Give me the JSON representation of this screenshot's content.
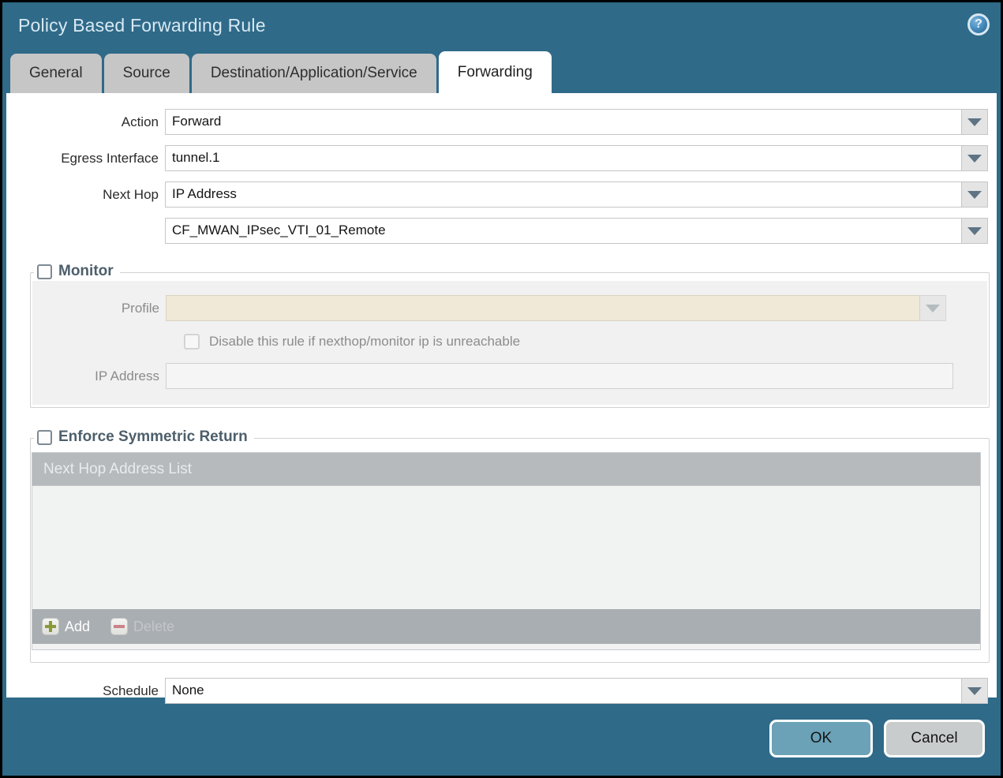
{
  "dialog": {
    "title": "Policy Based Forwarding Rule",
    "help_icon": "question-mark-circle",
    "help_glyph": "?"
  },
  "tabs": [
    {
      "label": "General",
      "active": false
    },
    {
      "label": "Source",
      "active": false
    },
    {
      "label": "Destination/Application/Service",
      "active": false
    },
    {
      "label": "Forwarding",
      "active": true
    }
  ],
  "form": {
    "action": {
      "label": "Action",
      "value": "Forward"
    },
    "egress_interface": {
      "label": "Egress Interface",
      "value": "tunnel.1"
    },
    "next_hop": {
      "label": "Next Hop",
      "value": "IP Address"
    },
    "next_hop_address": {
      "value": "CF_MWAN_IPsec_VTI_01_Remote"
    },
    "schedule": {
      "label": "Schedule",
      "value": "None"
    }
  },
  "monitor": {
    "legend": "Monitor",
    "checked": false,
    "profile": {
      "label": "Profile",
      "value": ""
    },
    "disable_rule": {
      "label": "Disable this rule if nexthop/monitor ip is unreachable",
      "checked": false
    },
    "ip_address": {
      "label": "IP Address",
      "value": ""
    }
  },
  "symmetric_return": {
    "legend": "Enforce Symmetric Return",
    "checked": false,
    "table": {
      "header": "Next Hop Address List",
      "rows": []
    },
    "add_label": "Add",
    "delete_label": "Delete",
    "delete_disabled": true
  },
  "footer": {
    "ok_label": "OK",
    "cancel_label": "Cancel"
  },
  "colors": {
    "dialog_teal": "#2f6a89",
    "title_text": "#d9e9f2",
    "tab_inactive_bg": "#c6c6c6",
    "tab_active_bg": "#ffffff",
    "disabled_combo_bg": "#f0e9d8",
    "panel_bg": "#f1f1f1",
    "table_header_bg": "#b6babd",
    "table_body_bg": "#f1f2f2",
    "table_footer_bg": "#a9aeb2",
    "legend_text": "#4d5f6b",
    "ok_button_bg": "#6ba2b7",
    "cancel_button_bg": "#c9cccd",
    "add_plus": "#8a9a3a",
    "delete_minus": "#cb8288"
  }
}
